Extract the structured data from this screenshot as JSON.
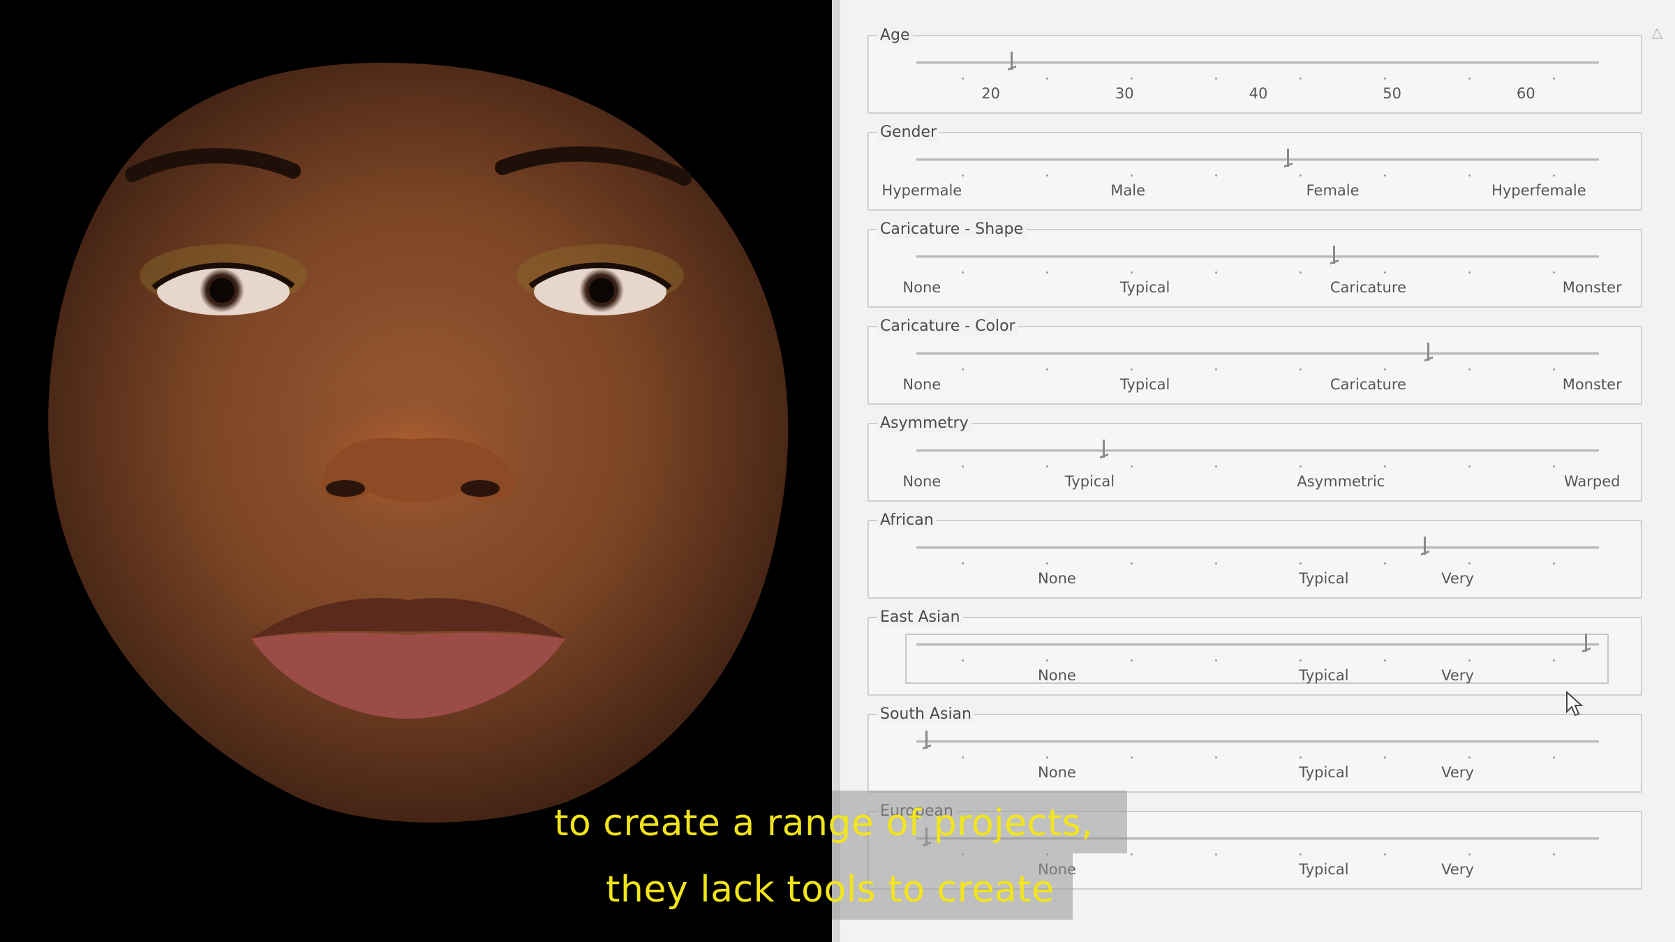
{
  "sliders": [
    {
      "id": "age",
      "title": "Age",
      "value_fraction": 0.14,
      "labels": [
        {
          "text": "20",
          "pos": 0.109
        },
        {
          "text": "30",
          "pos": 0.305
        },
        {
          "text": "40",
          "pos": 0.501
        },
        {
          "text": "50",
          "pos": 0.697
        },
        {
          "text": "60",
          "pos": 0.893
        }
      ]
    },
    {
      "id": "gender",
      "title": "Gender",
      "value_fraction": 0.545,
      "labels": [
        {
          "text": "Hypermale",
          "pos": 0.008
        },
        {
          "text": "Male",
          "pos": 0.31
        },
        {
          "text": "Female",
          "pos": 0.61
        },
        {
          "text": "Hyperfemale",
          "pos": 0.912
        }
      ]
    },
    {
      "id": "caricature-shape",
      "title": "Caricature - Shape",
      "value_fraction": 0.612,
      "labels": [
        {
          "text": "None",
          "pos": 0.008
        },
        {
          "text": "Typical",
          "pos": 0.335
        },
        {
          "text": "Caricature",
          "pos": 0.662
        },
        {
          "text": "Monster",
          "pos": 0.99
        }
      ]
    },
    {
      "id": "caricature-color",
      "title": "Caricature - Color",
      "value_fraction": 0.75,
      "labels": [
        {
          "text": "None",
          "pos": 0.008
        },
        {
          "text": "Typical",
          "pos": 0.335
        },
        {
          "text": "Caricature",
          "pos": 0.662
        },
        {
          "text": "Monster",
          "pos": 0.99
        }
      ]
    },
    {
      "id": "asymmetry",
      "title": "Asymmetry",
      "value_fraction": 0.275,
      "labels": [
        {
          "text": "None",
          "pos": 0.008
        },
        {
          "text": "Typical",
          "pos": 0.254
        },
        {
          "text": "Asymmetric",
          "pos": 0.622
        },
        {
          "text": "Warped",
          "pos": 0.99
        }
      ]
    },
    {
      "id": "african",
      "title": "African",
      "value_fraction": 0.745,
      "labels": [
        {
          "text": "None",
          "pos": 0.206
        },
        {
          "text": "Typical",
          "pos": 0.597
        },
        {
          "text": "Very",
          "pos": 0.793
        }
      ]
    },
    {
      "id": "east-asian",
      "title": "East Asian",
      "value_fraction": 0.982,
      "focused": true,
      "labels": [
        {
          "text": "None",
          "pos": 0.206
        },
        {
          "text": "Typical",
          "pos": 0.597
        },
        {
          "text": "Very",
          "pos": 0.793
        }
      ]
    },
    {
      "id": "south-asian",
      "title": "South Asian",
      "value_fraction": 0.015,
      "labels": [
        {
          "text": "None",
          "pos": 0.206
        },
        {
          "text": "Typical",
          "pos": 0.597
        },
        {
          "text": "Very",
          "pos": 0.793
        }
      ]
    },
    {
      "id": "european",
      "title": "European",
      "value_fraction": 0.015,
      "labels": [
        {
          "text": "None",
          "pos": 0.206
        },
        {
          "text": "Typical",
          "pos": 0.597
        },
        {
          "text": "Very",
          "pos": 0.793
        }
      ]
    }
  ],
  "subtitles": {
    "line1": "to create a range of projects,",
    "line2": "they lack tools to create"
  },
  "colors": {
    "subtitle": "#f2e51a",
    "panel": "#f2f2f2"
  }
}
